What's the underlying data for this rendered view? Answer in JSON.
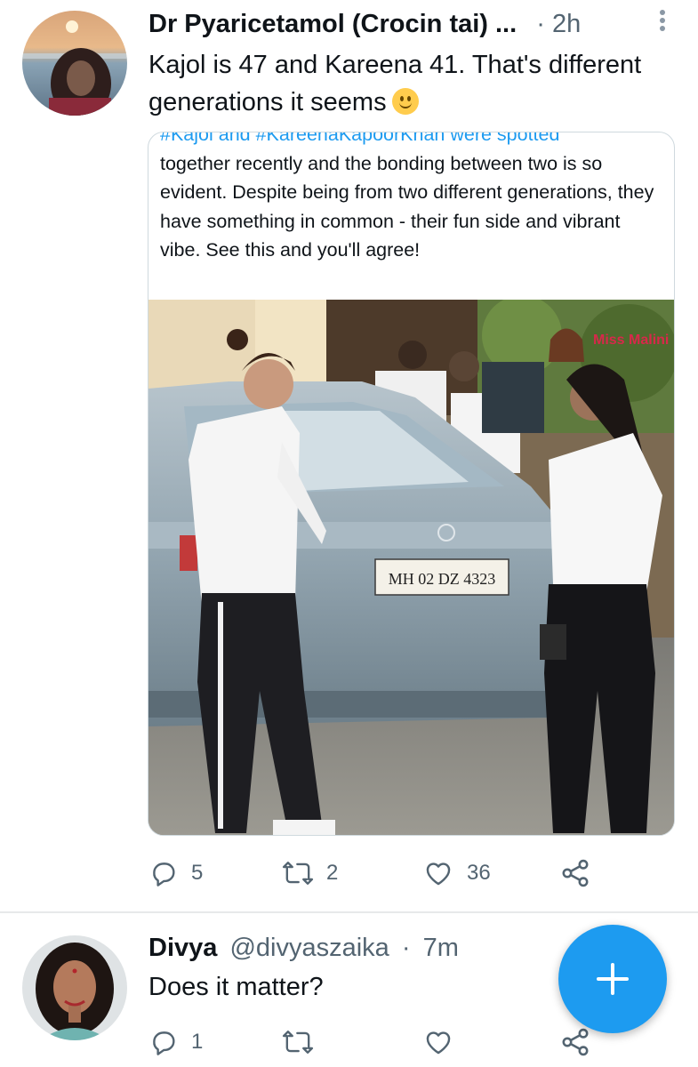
{
  "tweets": [
    {
      "author_name": "Dr Pyaricetamol (Crocin tai) ...",
      "separator": "·",
      "time": "2h",
      "text": "Kajol is 47 and Kareena 41. That's different generations it seems",
      "media": {
        "caption_hashtags_line": "#Kajol and #KareenaKapoorKhan were spotted",
        "caption": "together recently and the bonding between two is so evident. Despite being from two different generations, they have something in common - their fun side and vibrant vibe. See this and you'll agree!",
        "photo": {
          "license_plate": "MH 02 DZ 4323",
          "watermark": "Miss Malini"
        }
      },
      "actions": {
        "replies": "5",
        "retweets": "2",
        "likes": "36"
      }
    },
    {
      "author_name": "Divya",
      "handle": "@divyaszaika",
      "separator": "·",
      "time": "7m",
      "text": "Does it matter?",
      "actions": {
        "replies": "1",
        "retweets": "",
        "likes": ""
      }
    }
  ],
  "colors": {
    "accent": "#1d9bf0",
    "text": "#0f1419",
    "secondary_text": "#536471",
    "divider": "#e7e9ea"
  },
  "icons": [
    "reply-icon",
    "retweet-icon",
    "like-icon",
    "share-icon",
    "more-options-icon",
    "compose-plus-icon",
    "smiling-face-emoji"
  ]
}
